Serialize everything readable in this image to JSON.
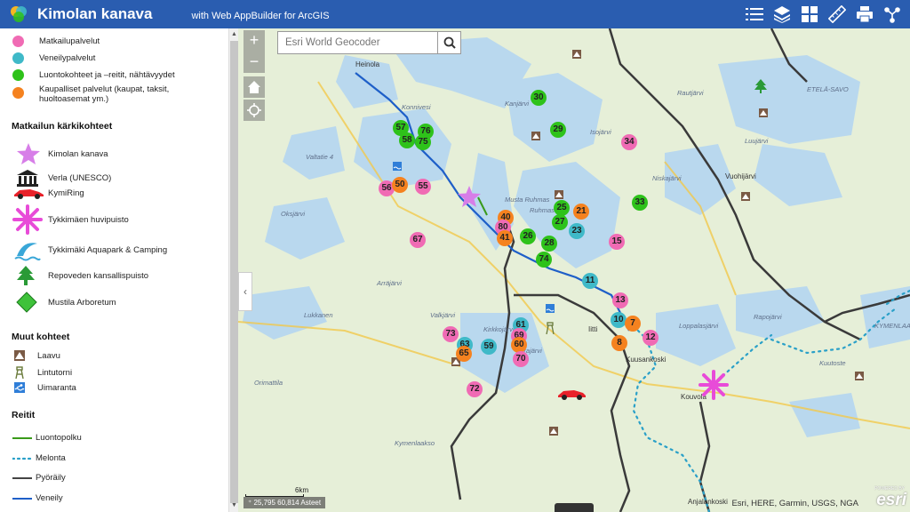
{
  "header": {
    "title": "Kimolan kanava",
    "subtitle": "with Web AppBuilder for ArcGIS",
    "tools": [
      "list-icon",
      "layers-icon",
      "basemap-gallery-icon",
      "measure-icon",
      "print-icon",
      "share-icon"
    ]
  },
  "legend": {
    "points": [
      {
        "label": "Matkailupalvelut",
        "color": "#f06bb4"
      },
      {
        "label": "Veneilypalvelut",
        "color": "#3fb9c8"
      },
      {
        "label": "Luontokohteet ja –reitit, nähtävyydet",
        "color": "#2ec21a"
      },
      {
        "label": "Kaupalliset palvelut (kaupat, taksit, huoltoasemat ym.)",
        "color": "#f5821f"
      }
    ],
    "section1": "Matkailun kärkikohteet",
    "highlights": [
      {
        "label": "Kimolan kanava",
        "icon": "star-icon"
      },
      {
        "label": "Verla (UNESCO)",
        "icon": "museum-icon"
      },
      {
        "label": "KymiRing",
        "icon": "race-car-icon"
      },
      {
        "label": "Tykkimäen huvipuisto",
        "icon": "amusement-park-icon"
      },
      {
        "label": "Tykkimäki Aquapark & Camping",
        "icon": "water-slide-icon"
      },
      {
        "label": "Repoveden kansallispuisto",
        "icon": "pine-tree-icon"
      },
      {
        "label": "Mustila Arboretum",
        "icon": "diamond-icon"
      }
    ],
    "section2": "Muut kohteet",
    "others": [
      {
        "label": "Laavu",
        "icon": "shelter-icon"
      },
      {
        "label": "Lintutorni",
        "icon": "bird-tower-icon"
      },
      {
        "label": "Uimaranta",
        "icon": "swimming-icon"
      }
    ],
    "section3": "Reitit",
    "routes": [
      {
        "label": "Luontopolku",
        "color": "#3a9a1a",
        "style": "solid"
      },
      {
        "label": "Melonta",
        "color": "#2aa0c8",
        "style": "dotted"
      },
      {
        "label": "Pyöräily",
        "color": "#444444",
        "style": "solid"
      },
      {
        "label": "Veneily",
        "color": "#1e5fc8",
        "style": "solid"
      }
    ]
  },
  "map": {
    "search_placeholder": "Esri World Geocoder",
    "zoom_in": "+",
    "zoom_out": "−",
    "coordinates": "25,795 60,814 Asteet",
    "scale": "6km",
    "attribution": "Esri, HERE, Garmin, USGS, NGA",
    "esri_logo": "esri",
    "powered_by": "POWERED BY",
    "places": [
      "Heinola",
      "Konnivesi",
      "Kanjärvi",
      "Rautjärvi",
      "ETELÄ-SAVO",
      "Luujärvi",
      "Niskajärvi",
      "Vuohijärvi",
      "Musta Ruhmas",
      "Valtatie 4",
      "Oksjärvi",
      "Ruhmas",
      "Arräjärvi",
      "Lukkanen",
      "Valkjärvi",
      "Kirkkojärvi",
      "Urajärvi",
      "Iitti",
      "Kouvola",
      "Kuusankoski",
      "Rapojärvi",
      "Loppalasjärvi",
      "Kuutoste",
      "KYMENLAAKSO",
      "Orimattila",
      "Kymenlaakso",
      "Anjalankoski",
      "Isojärvi"
    ],
    "markers": [
      {
        "n": "30",
        "c": "green"
      },
      {
        "n": "29",
        "c": "green"
      },
      {
        "n": "34",
        "c": "pink"
      },
      {
        "n": "57",
        "c": "green"
      },
      {
        "n": "76",
        "c": "green"
      },
      {
        "n": "58",
        "c": "green"
      },
      {
        "n": "75",
        "c": "green"
      },
      {
        "n": "56",
        "c": "pink"
      },
      {
        "n": "50",
        "c": "orange"
      },
      {
        "n": "55",
        "c": "pink"
      },
      {
        "n": "33",
        "c": "green"
      },
      {
        "n": "25",
        "c": "green"
      },
      {
        "n": "21",
        "c": "orange"
      },
      {
        "n": "27",
        "c": "green"
      },
      {
        "n": "23",
        "c": "cyan"
      },
      {
        "n": "40",
        "c": "orange"
      },
      {
        "n": "80",
        "c": "pink"
      },
      {
        "n": "41",
        "c": "orange"
      },
      {
        "n": "26",
        "c": "green"
      },
      {
        "n": "28",
        "c": "green"
      },
      {
        "n": "74",
        "c": "green"
      },
      {
        "n": "67",
        "c": "pink"
      },
      {
        "n": "15",
        "c": "pink"
      },
      {
        "n": "11",
        "c": "cyan"
      },
      {
        "n": "13",
        "c": "pink"
      },
      {
        "n": "10",
        "c": "cyan"
      },
      {
        "n": "7",
        "c": "orange"
      },
      {
        "n": "8",
        "c": "orange"
      },
      {
        "n": "12",
        "c": "pink"
      },
      {
        "n": "61",
        "c": "cyan"
      },
      {
        "n": "69",
        "c": "pink"
      },
      {
        "n": "60",
        "c": "orange"
      },
      {
        "n": "73",
        "c": "pink"
      },
      {
        "n": "63",
        "c": "cyan"
      },
      {
        "n": "65",
        "c": "orange"
      },
      {
        "n": "59",
        "c": "cyan"
      },
      {
        "n": "70",
        "c": "pink"
      },
      {
        "n": "72",
        "c": "pink"
      }
    ]
  }
}
